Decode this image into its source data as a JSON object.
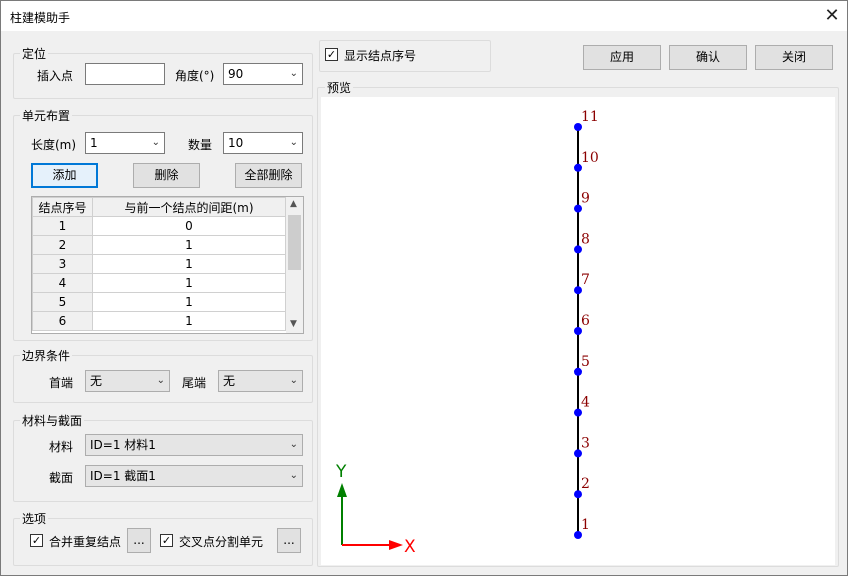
{
  "window": {
    "title": "柱建模助手",
    "close_glyph": "✕"
  },
  "position": {
    "group_title": "定位",
    "insert_point_label": "插入点",
    "insert_point_value": "",
    "angle_label": "角度(°)",
    "angle_value": "90"
  },
  "unit_layout": {
    "group_title": "单元布置",
    "length_label": "长度(m)",
    "length_value": "1",
    "count_label": "数量",
    "count_value": "10",
    "add_button": "添加",
    "delete_button": "删除",
    "delete_all_button": "全部删除",
    "table_headers": [
      "结点序号",
      "与前一个结点的间距(m)"
    ],
    "rows": [
      [
        "1",
        "0"
      ],
      [
        "2",
        "1"
      ],
      [
        "3",
        "1"
      ],
      [
        "4",
        "1"
      ],
      [
        "5",
        "1"
      ],
      [
        "6",
        "1"
      ]
    ]
  },
  "boundary": {
    "group_title": "边界条件",
    "head_label": "首端",
    "head_value": "无",
    "tail_label": "尾端",
    "tail_value": "无"
  },
  "material_section": {
    "group_title": "材料与截面",
    "material_label": "材料",
    "material_value": "ID=1  材料1",
    "section_label": "截面",
    "section_value": "ID=1  截面1"
  },
  "options": {
    "group_title": "选项",
    "merge_nodes_label": "合并重复结点",
    "merge_nodes_checked": "✓",
    "split_label": "交叉点分割单元",
    "split_checked": "✓",
    "more_button": "..."
  },
  "display": {
    "show_node_numbers_label": "显示结点序号",
    "show_node_numbers_checked": "✓"
  },
  "actions": {
    "apply": "应用",
    "confirm": "确认",
    "close": "关闭"
  },
  "preview": {
    "title": "预览",
    "node_labels": [
      "1",
      "2",
      "3",
      "4",
      "5",
      "6",
      "7",
      "8",
      "9",
      "10",
      "11"
    ],
    "axis_x": "X",
    "axis_y": "Y",
    "colors": {
      "node": "#0000ff",
      "label": "#8b0000",
      "x_axis": "#ff0000",
      "y_axis": "#008000",
      "member": "#000000"
    }
  },
  "arrow_glyph": "⌄"
}
